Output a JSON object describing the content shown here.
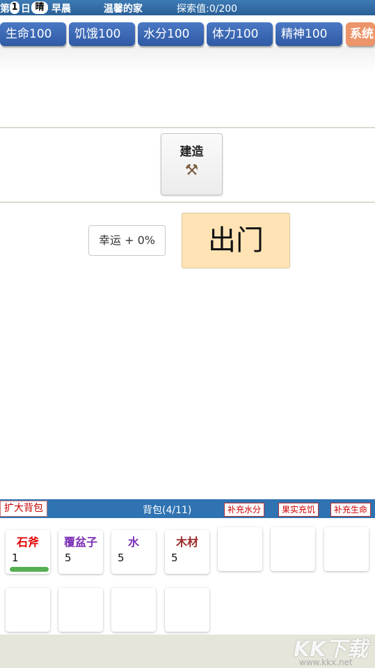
{
  "status": {
    "day_prefix": "第",
    "day_number": "1",
    "day_suffix": "日",
    "weather": "晴",
    "time_of_day": "早晨",
    "location": "温馨的家",
    "explore": "探索值:0/200"
  },
  "stats": [
    "生命100",
    "饥饿100",
    "水分100",
    "体力100",
    "精神100"
  ],
  "system_button": "系统",
  "build": {
    "label": "建造",
    "icon": "hammer-pick-icon"
  },
  "luck": "幸运 + 0%",
  "go_out": "出门",
  "backpack": {
    "expand": "扩大背包",
    "title": "背包(4/11)",
    "actions": [
      "补充水分",
      "果实充饥",
      "补充生命"
    ],
    "items": [
      {
        "name": "石斧",
        "qty": "1",
        "color": "#e00000",
        "durability": 1.0
      },
      {
        "name": "覆盆子",
        "qty": "5",
        "color": "#7a2fb5"
      },
      {
        "name": "水",
        "qty": "5",
        "color": "#7a2fb5"
      },
      {
        "name": "木材",
        "qty": "5",
        "color": "#9a2a2a"
      }
    ]
  },
  "watermark": {
    "logo": "KK下载",
    "url": "www.kkx.net"
  }
}
